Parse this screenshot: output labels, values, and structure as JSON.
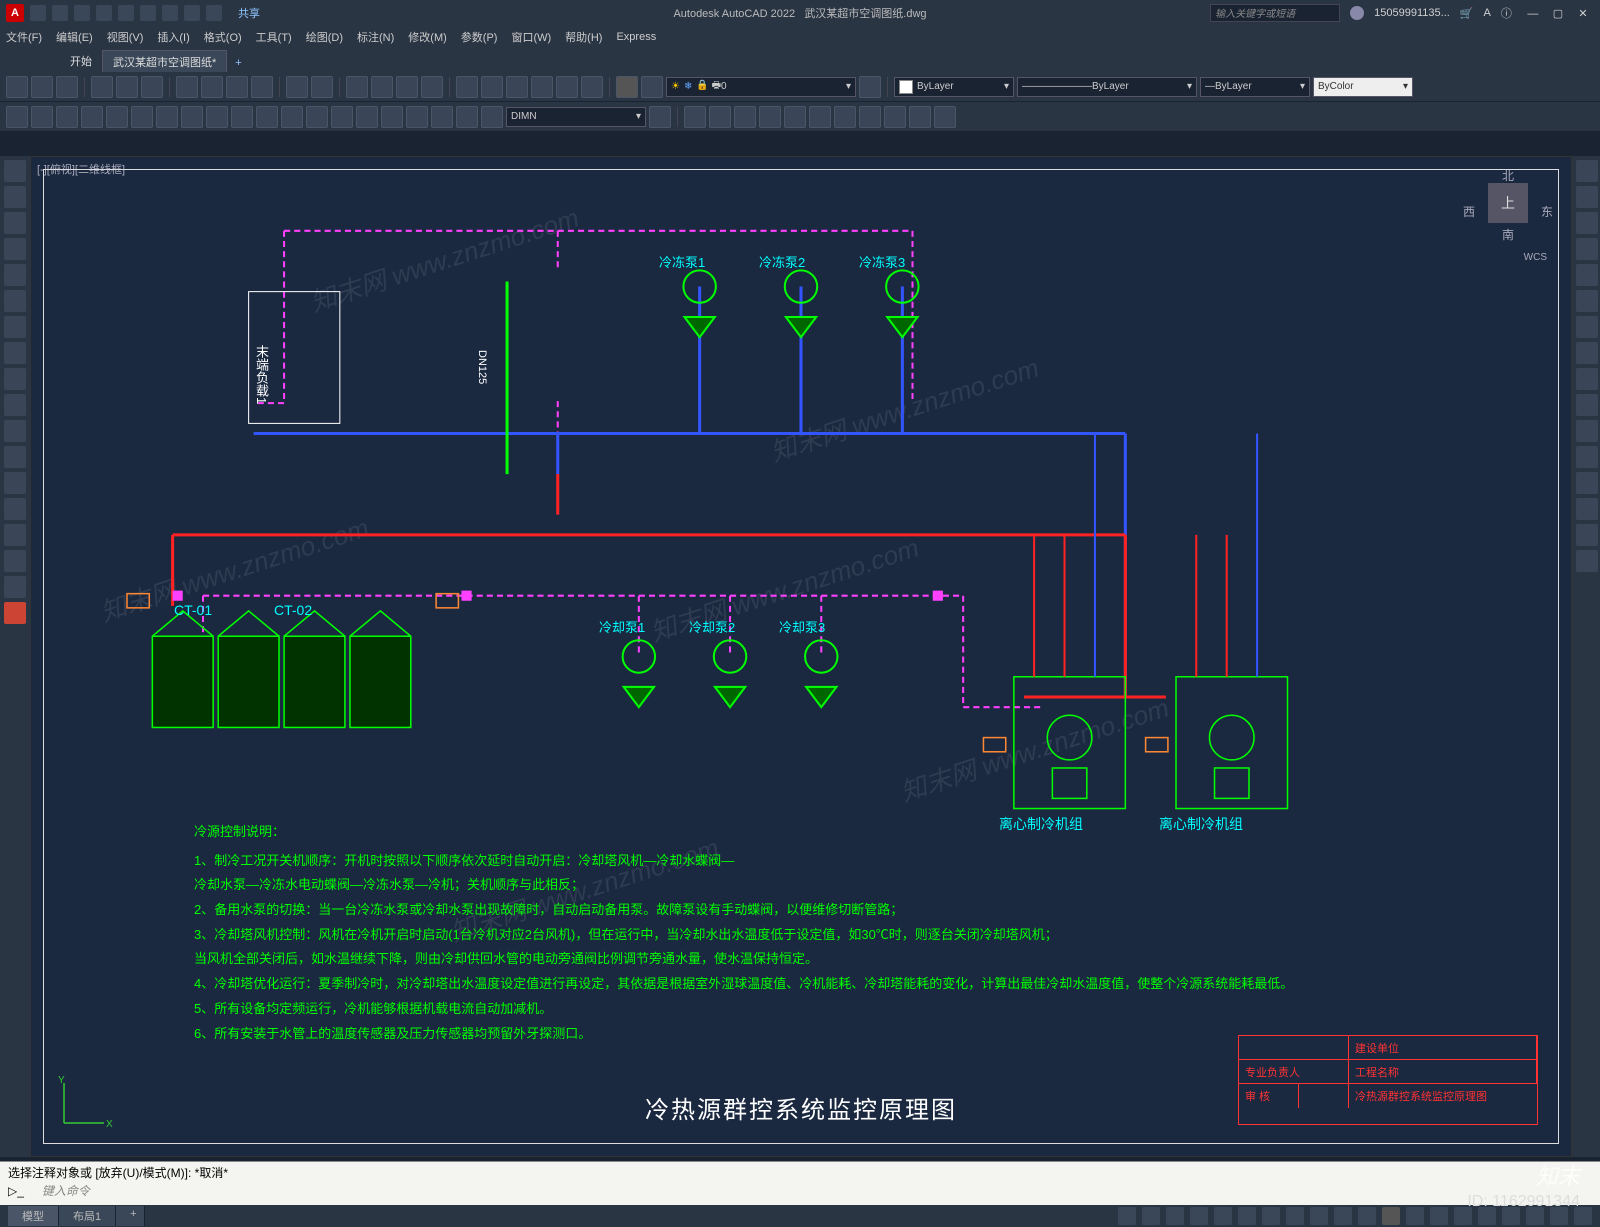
{
  "title_bar": {
    "app_logo_letter": "A",
    "share_label": "共享",
    "app_title": "Autodesk AutoCAD 2022",
    "doc_name": "武汉某超市空调图纸.dwg",
    "search_placeholder": "输入关键字或短语",
    "user_label": "15059991135...",
    "window_controls": {
      "min": "—",
      "max": "▢",
      "close": "✕"
    }
  },
  "menus": [
    "文件(F)",
    "编辑(E)",
    "视图(V)",
    "插入(I)",
    "格式(O)",
    "工具(T)",
    "绘图(D)",
    "标注(N)",
    "修改(M)",
    "参数(P)",
    "窗口(W)",
    "帮助(H)",
    "Express"
  ],
  "doc_tabs": {
    "start": "开始",
    "active": "武汉某超市空调图纸*"
  },
  "props_bar": {
    "dim_style": "DIMN",
    "layer_val": "0",
    "group1": "ByLayer",
    "group2": "ByLayer",
    "group3": "ByLayer",
    "color": "ByColor"
  },
  "view_cube": {
    "top": "上",
    "n": "北",
    "s": "南",
    "w": "西",
    "e": "东",
    "wcs": "WCS"
  },
  "drawing": {
    "pumps_top": [
      "冷冻泵1",
      "冷冻泵2",
      "冷冻泵3"
    ],
    "pumps_bottom": [
      "冷却泵1",
      "冷却泵2",
      "冷却泵3"
    ],
    "ct_labels": [
      "CT-01",
      "CT-02"
    ],
    "end_load": "末端负载1",
    "pipe_dn": "DN125",
    "chiller1": "离心制冷机组",
    "chiller2": "离心制冷机组",
    "title": "冷热源群控系统监控原理图"
  },
  "notes": {
    "heading": "冷源控制说明：",
    "lines": [
      "1、制冷工况开关机顺序：开机时按照以下顺序依次延时自动开启：冷却塔风机—冷却水蝶阀—",
      "   冷却水泵—冷冻水电动蝶阀—冷冻水泵—冷机；关机顺序与此相反；",
      "2、备用水泵的切换：当一台冷冻水泵或冷却水泵出现故障时，自动启动备用泵。故障泵设有手动蝶阀，以便维修切断管路；",
      "3、冷却塔风机控制：风机在冷机开启时启动(1台冷机对应2台风机)，但在运行中，当冷却水出水温度低于设定值，如30℃时，则逐台关闭冷却塔风机；",
      "   当风机全部关闭后，如水温继续下降，则由冷却供回水管的电动旁通阀比例调节旁通水量，使水温保持恒定。",
      "4、冷却塔优化运行：夏季制冷时，对冷却塔出水温度设定值进行再设定，其依据是根据室外湿球温度值、冷机能耗、冷却塔能耗的变化，计算出最佳冷却水温度值，使整个冷源系统能耗最低。",
      "5、所有设备均定频运行，冷机能够根据机载电流自动加减机。",
      "6、所有安装于水管上的温度传感器及压力传感器均预留外牙探测口。"
    ]
  },
  "title_block": {
    "row1_b": "建设单位",
    "row2_a": "专业负责人",
    "row2_b": "工程名称",
    "row3_a": "审 核",
    "row3_c": "冷热源群控系统监控原理图"
  },
  "command": {
    "history": "选择注释对象或 [放弃(U)/模式(M)]: *取消*",
    "prompt_icon": "▷_",
    "prompt": "键入命令"
  },
  "status": {
    "tab_model": "模型",
    "tab_layout1": "布局1"
  },
  "watermark_text": "知末网 www.znzmo.com",
  "corner_logo": "知末",
  "corner_id": "ID: 1162991344"
}
